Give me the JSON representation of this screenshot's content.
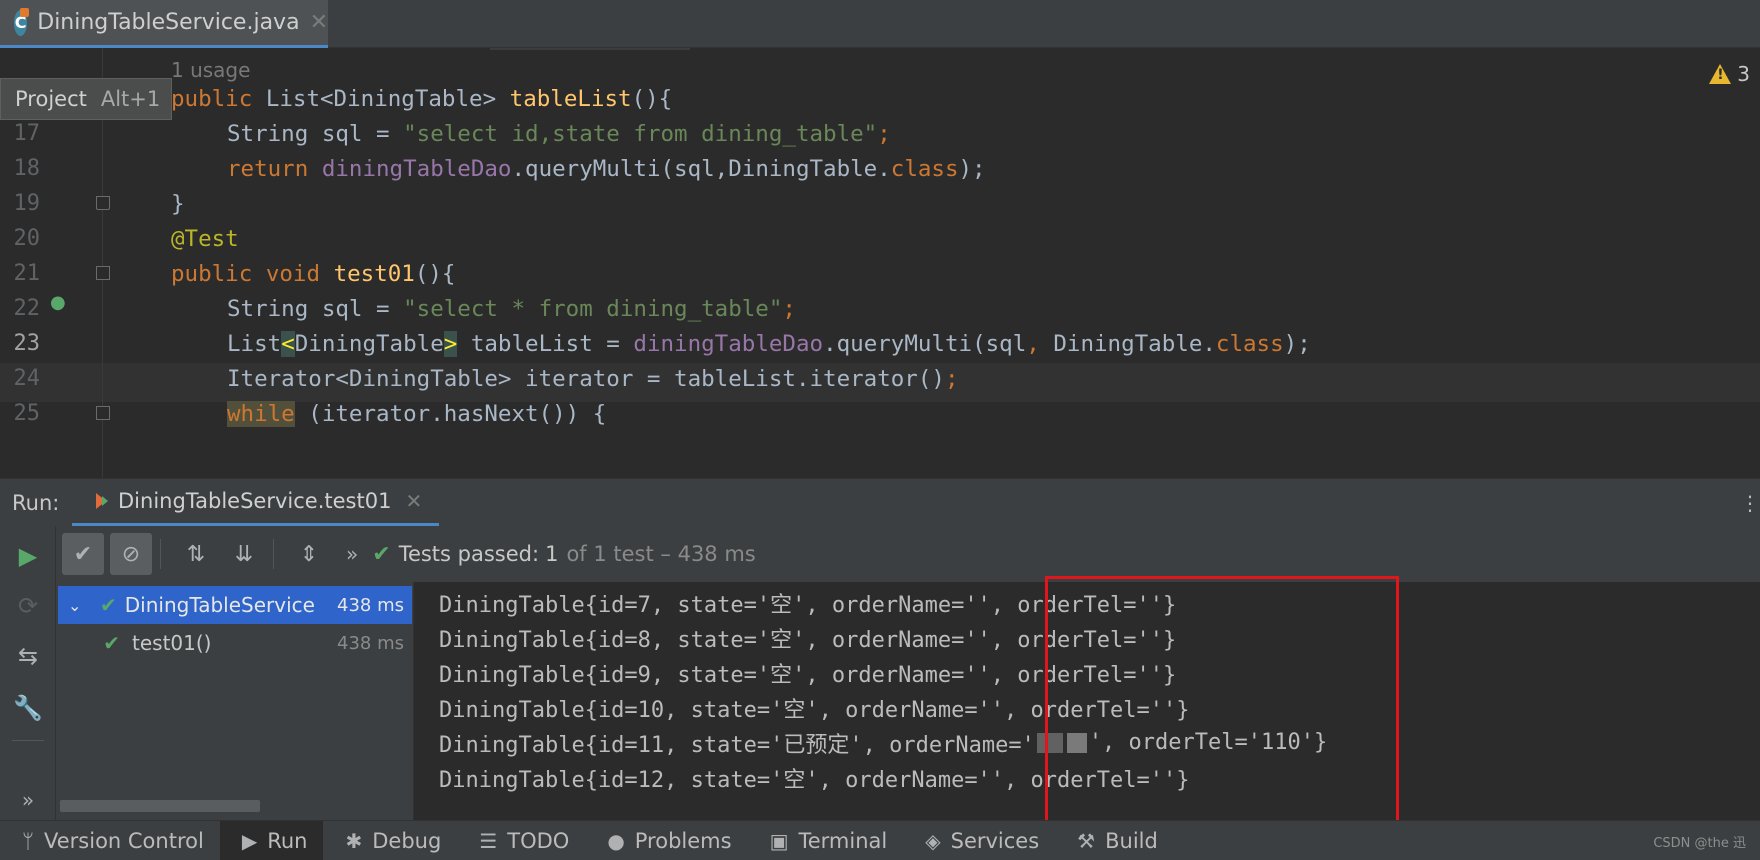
{
  "editor_tab": {
    "label": "DiningTableService.java",
    "icon": "C"
  },
  "editor": {
    "usage_hint": "1 usage",
    "project_tooltip": {
      "label": "Project",
      "shortcut": "Alt+1"
    },
    "warning_count": "3",
    "line_numbers": {
      "l17": "17",
      "l18": "18",
      "l19": "19",
      "l20": "20",
      "l21": "21",
      "l22": "22",
      "l23": "23",
      "l24": "24",
      "l25": "25"
    },
    "code": {
      "l16_kw": "public ",
      "l16_type": "List<DiningTable> ",
      "l16_fn": "tableList",
      "l16_rest": "(){",
      "l17_a": "String sql = ",
      "l17_str": "\"select id,state from dining_table\"",
      "l17_semi": ";",
      "l18_kw": "return ",
      "l18_fld": "diningTableDao",
      "l18_mid": ".queryMulti(sql,DiningTable.",
      "l18_kw2": "class",
      "l18_end": ");",
      "l19": "}",
      "l20": "@Test",
      "l21_kw": "public void ",
      "l21_fn": "test01",
      "l21_rest": "(){",
      "l22_a": "String sql = ",
      "l22_str": "\"select * from dining_table\"",
      "l22_semi": ";",
      "l23_a": "List",
      "l23_lt": "<",
      "l23_type": "DiningTable",
      "l23_gt": ">",
      "l23_b": " tableList = ",
      "l23_fld": "diningTableDao",
      "l23_c": ".queryMulti(sql",
      "l23_comma": ", ",
      "l23_d": "DiningTable.",
      "l23_kw": "class",
      "l23_end": ");",
      "l24_a": "Iterator<DiningTable> iterator = tableList.iterator()",
      "l24_semi": ";",
      "l25_kw": "while",
      "l25_rest": " (iterator.hasNext()) {"
    }
  },
  "run_window": {
    "label": "Run:",
    "tab_label": "DiningTableService.test01",
    "more": "⋮"
  },
  "run_toolbar": {
    "more": "»",
    "status_label": "Tests passed:",
    "status_count": "1",
    "status_rest": "of 1 test – 438 ms"
  },
  "test_tree": {
    "root": {
      "label": "DiningTableService",
      "time": "438 ms"
    },
    "child": {
      "label": "test01()",
      "time": "438 ms"
    }
  },
  "console": {
    "lines": [
      "DiningTable{id=7, state='空', orderName='', orderTel=''}",
      "DiningTable{id=8, state='空', orderName='', orderTel=''}",
      "DiningTable{id=9, state='空', orderName='', orderTel=''}",
      "DiningTable{id=10, state='空', orderName='', orderTel=''}",
      "DiningTable{id=12, state='空', orderName='', orderTel=''}"
    ],
    "line_11_a": "DiningTable{id=11, state='已预定', orderName='",
    "line_11_b": "', orderTel='110'}"
  },
  "bottom_bar": {
    "items": [
      "Version Control",
      "Run",
      "Debug",
      "TODO",
      "Problems",
      "Terminal",
      "Services",
      "Build"
    ]
  },
  "watermark": "CSDN @the 迅",
  "icons": {
    "vcs": "branch-icon",
    "run": "play-icon",
    "debug": "bug-icon",
    "todo": "list-icon",
    "problems": "exclamation-icon",
    "terminal": "terminal-icon",
    "services": "services-icon",
    "build": "hammer-icon"
  }
}
